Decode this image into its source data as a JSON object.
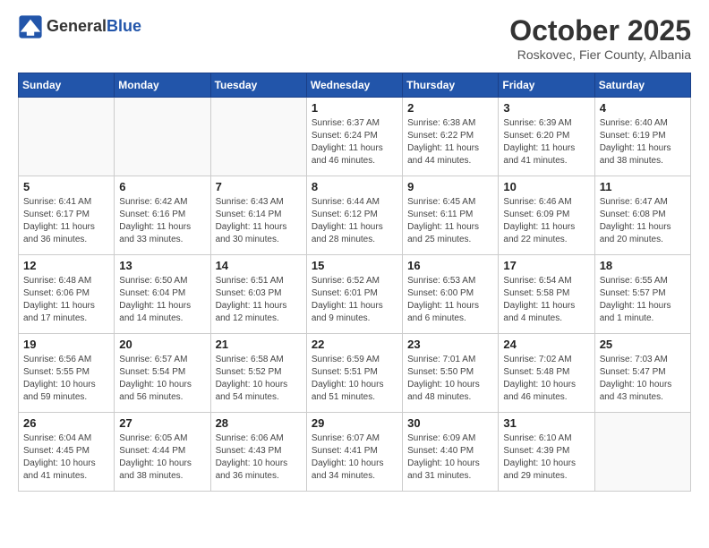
{
  "header": {
    "logo_line1": "General",
    "logo_line2": "Blue",
    "month_title": "October 2025",
    "location": "Roskovec, Fier County, Albania"
  },
  "weekdays": [
    "Sunday",
    "Monday",
    "Tuesday",
    "Wednesday",
    "Thursday",
    "Friday",
    "Saturday"
  ],
  "weeks": [
    [
      {
        "day": "",
        "info": ""
      },
      {
        "day": "",
        "info": ""
      },
      {
        "day": "",
        "info": ""
      },
      {
        "day": "1",
        "info": "Sunrise: 6:37 AM\nSunset: 6:24 PM\nDaylight: 11 hours and 46 minutes."
      },
      {
        "day": "2",
        "info": "Sunrise: 6:38 AM\nSunset: 6:22 PM\nDaylight: 11 hours and 44 minutes."
      },
      {
        "day": "3",
        "info": "Sunrise: 6:39 AM\nSunset: 6:20 PM\nDaylight: 11 hours and 41 minutes."
      },
      {
        "day": "4",
        "info": "Sunrise: 6:40 AM\nSunset: 6:19 PM\nDaylight: 11 hours and 38 minutes."
      }
    ],
    [
      {
        "day": "5",
        "info": "Sunrise: 6:41 AM\nSunset: 6:17 PM\nDaylight: 11 hours and 36 minutes."
      },
      {
        "day": "6",
        "info": "Sunrise: 6:42 AM\nSunset: 6:16 PM\nDaylight: 11 hours and 33 minutes."
      },
      {
        "day": "7",
        "info": "Sunrise: 6:43 AM\nSunset: 6:14 PM\nDaylight: 11 hours and 30 minutes."
      },
      {
        "day": "8",
        "info": "Sunrise: 6:44 AM\nSunset: 6:12 PM\nDaylight: 11 hours and 28 minutes."
      },
      {
        "day": "9",
        "info": "Sunrise: 6:45 AM\nSunset: 6:11 PM\nDaylight: 11 hours and 25 minutes."
      },
      {
        "day": "10",
        "info": "Sunrise: 6:46 AM\nSunset: 6:09 PM\nDaylight: 11 hours and 22 minutes."
      },
      {
        "day": "11",
        "info": "Sunrise: 6:47 AM\nSunset: 6:08 PM\nDaylight: 11 hours and 20 minutes."
      }
    ],
    [
      {
        "day": "12",
        "info": "Sunrise: 6:48 AM\nSunset: 6:06 PM\nDaylight: 11 hours and 17 minutes."
      },
      {
        "day": "13",
        "info": "Sunrise: 6:50 AM\nSunset: 6:04 PM\nDaylight: 11 hours and 14 minutes."
      },
      {
        "day": "14",
        "info": "Sunrise: 6:51 AM\nSunset: 6:03 PM\nDaylight: 11 hours and 12 minutes."
      },
      {
        "day": "15",
        "info": "Sunrise: 6:52 AM\nSunset: 6:01 PM\nDaylight: 11 hours and 9 minutes."
      },
      {
        "day": "16",
        "info": "Sunrise: 6:53 AM\nSunset: 6:00 PM\nDaylight: 11 hours and 6 minutes."
      },
      {
        "day": "17",
        "info": "Sunrise: 6:54 AM\nSunset: 5:58 PM\nDaylight: 11 hours and 4 minutes."
      },
      {
        "day": "18",
        "info": "Sunrise: 6:55 AM\nSunset: 5:57 PM\nDaylight: 11 hours and 1 minute."
      }
    ],
    [
      {
        "day": "19",
        "info": "Sunrise: 6:56 AM\nSunset: 5:55 PM\nDaylight: 10 hours and 59 minutes."
      },
      {
        "day": "20",
        "info": "Sunrise: 6:57 AM\nSunset: 5:54 PM\nDaylight: 10 hours and 56 minutes."
      },
      {
        "day": "21",
        "info": "Sunrise: 6:58 AM\nSunset: 5:52 PM\nDaylight: 10 hours and 54 minutes."
      },
      {
        "day": "22",
        "info": "Sunrise: 6:59 AM\nSunset: 5:51 PM\nDaylight: 10 hours and 51 minutes."
      },
      {
        "day": "23",
        "info": "Sunrise: 7:01 AM\nSunset: 5:50 PM\nDaylight: 10 hours and 48 minutes."
      },
      {
        "day": "24",
        "info": "Sunrise: 7:02 AM\nSunset: 5:48 PM\nDaylight: 10 hours and 46 minutes."
      },
      {
        "day": "25",
        "info": "Sunrise: 7:03 AM\nSunset: 5:47 PM\nDaylight: 10 hours and 43 minutes."
      }
    ],
    [
      {
        "day": "26",
        "info": "Sunrise: 6:04 AM\nSunset: 4:45 PM\nDaylight: 10 hours and 41 minutes."
      },
      {
        "day": "27",
        "info": "Sunrise: 6:05 AM\nSunset: 4:44 PM\nDaylight: 10 hours and 38 minutes."
      },
      {
        "day": "28",
        "info": "Sunrise: 6:06 AM\nSunset: 4:43 PM\nDaylight: 10 hours and 36 minutes."
      },
      {
        "day": "29",
        "info": "Sunrise: 6:07 AM\nSunset: 4:41 PM\nDaylight: 10 hours and 34 minutes."
      },
      {
        "day": "30",
        "info": "Sunrise: 6:09 AM\nSunset: 4:40 PM\nDaylight: 10 hours and 31 minutes."
      },
      {
        "day": "31",
        "info": "Sunrise: 6:10 AM\nSunset: 4:39 PM\nDaylight: 10 hours and 29 minutes."
      },
      {
        "day": "",
        "info": ""
      }
    ]
  ]
}
